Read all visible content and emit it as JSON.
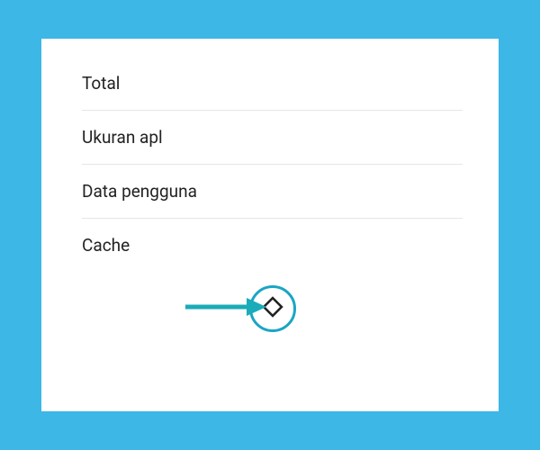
{
  "storage": {
    "items": [
      {
        "label": "Total"
      },
      {
        "label": "Ukuran apl"
      },
      {
        "label": "Data pengguna"
      },
      {
        "label": "Cache"
      }
    ]
  },
  "colors": {
    "accent": "#1ba5c4",
    "arrow": "#1aacb8"
  }
}
